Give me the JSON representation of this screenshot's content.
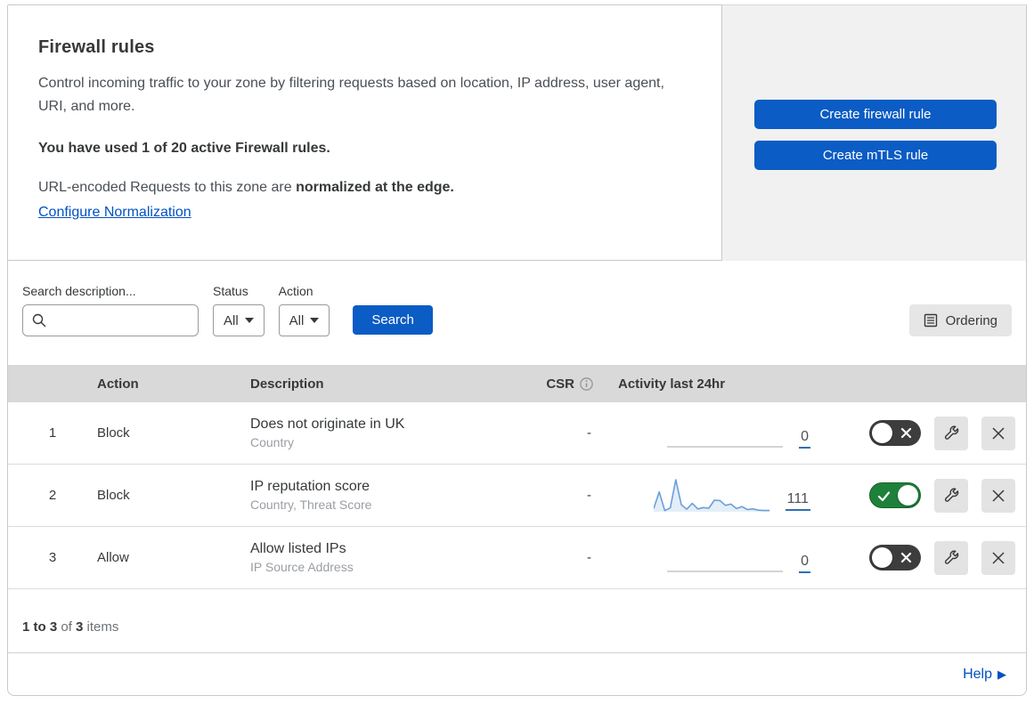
{
  "header": {
    "title": "Firewall rules",
    "description": "Control incoming traffic to your zone by filtering requests based on location, IP address, user agent, URI, and more.",
    "usage_text": "You have used 1 of 20 active Firewall rules.",
    "normalization_prefix": "URL-encoded Requests to this zone are ",
    "normalization_bold": "normalized at the edge.",
    "normalization_link": "Configure Normalization",
    "create_firewall_button": "Create firewall rule",
    "create_mtls_button": "Create mTLS rule"
  },
  "filters": {
    "search_label": "Search description...",
    "search_value": "",
    "status_label": "Status",
    "status_value": "All",
    "action_label": "Action",
    "action_value": "All",
    "search_button": "Search",
    "ordering_button": "Ordering"
  },
  "table": {
    "columns": {
      "action": "Action",
      "description": "Description",
      "csr": "CSR",
      "activity": "Activity last 24hr"
    },
    "rows": [
      {
        "num": "1",
        "action": "Block",
        "description": "Does not originate in UK",
        "criteria": "Country",
        "csr": "-",
        "count": "0",
        "enabled": false,
        "sparkline": null
      },
      {
        "num": "2",
        "action": "Block",
        "description": "IP reputation score",
        "criteria": "Country, Threat Score",
        "csr": "-",
        "count": "111",
        "enabled": true,
        "sparkline": [
          10,
          62,
          4,
          12,
          100,
          22,
          8,
          26,
          9,
          13,
          11,
          36,
          35,
          20,
          24,
          10,
          16,
          7,
          9,
          5,
          4,
          4
        ]
      },
      {
        "num": "3",
        "action": "Allow",
        "description": "Allow listed IPs",
        "criteria": "IP Source Address",
        "csr": "-",
        "count": "0",
        "enabled": false,
        "sparkline": null
      }
    ]
  },
  "footer": {
    "range_bold": "1 to 3",
    "of_text": " of ",
    "total_bold": "3",
    "items_text": " items",
    "help_label": "Help",
    "help_arrow": "▶"
  },
  "colors": {
    "accent_blue": "#0b5cc4",
    "link_blue": "#0051c3",
    "toggle_on_green": "#1e8139",
    "toggle_off_gray": "#3d3d3d",
    "sparkline_blue": "#6b9fd8",
    "table_header_gray": "#d9d9d9"
  }
}
